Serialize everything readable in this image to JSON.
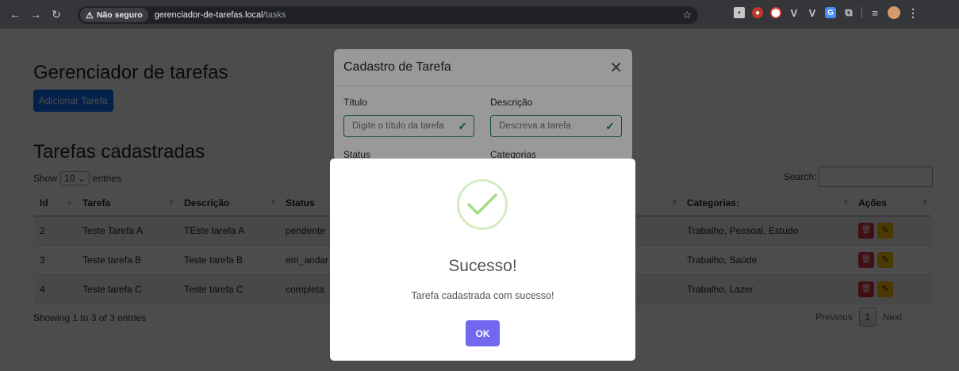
{
  "browser": {
    "security_label": "Não seguro",
    "url_host": "gerenciador-de-tarefas.local",
    "url_path": "/tasks"
  },
  "page": {
    "title": "Gerenciador de tarefas",
    "add_button": "Adicionar Tarefa",
    "section_title": "Tarefas cadastradas",
    "show_label": "Show",
    "entries_value": "10",
    "entries_label": "entries",
    "search_label": "Search:",
    "columns": [
      "Id",
      "Tarefa",
      "Descrição",
      "Status",
      "Categorias:",
      "Ações"
    ],
    "rows": [
      {
        "id": "2",
        "tarefa": "Teste Tarefa A",
        "descricao": "TEste tarefa A",
        "status": "pendente",
        "categorias": "Trabalho, Pessoal, Estudo"
      },
      {
        "id": "3",
        "tarefa": "Teste tarefa B",
        "descricao": "Teste tarefa B",
        "status": "em_andar",
        "categorias": "Trabalho, Saúde"
      },
      {
        "id": "4",
        "tarefa": "Teste tarefa C",
        "descricao": "Teste tarefa C",
        "status": "completa",
        "categorias": "Trabalho, Lazer"
      }
    ],
    "info": "Showing 1 to 3 of 3 entries",
    "previous": "Previous",
    "current_page": "1",
    "next": "Next"
  },
  "modal": {
    "title": "Cadastro de Tarefa",
    "titulo_label": "Título",
    "titulo_placeholder": "Digite o título da tarefa",
    "descricao_label": "Descrição",
    "descricao_placeholder": "Descreva a tarefa",
    "status_label": "Status",
    "categorias_label": "Categorias"
  },
  "alert": {
    "title": "Sucesso!",
    "text": "Tarefa cadastrada com sucesso!",
    "ok": "OK"
  },
  "colors": {
    "primary": "#0d6efd",
    "danger": "#dc3545",
    "warning": "#ffc107",
    "success": "#198754",
    "swal_confirm": "#7367f0"
  }
}
